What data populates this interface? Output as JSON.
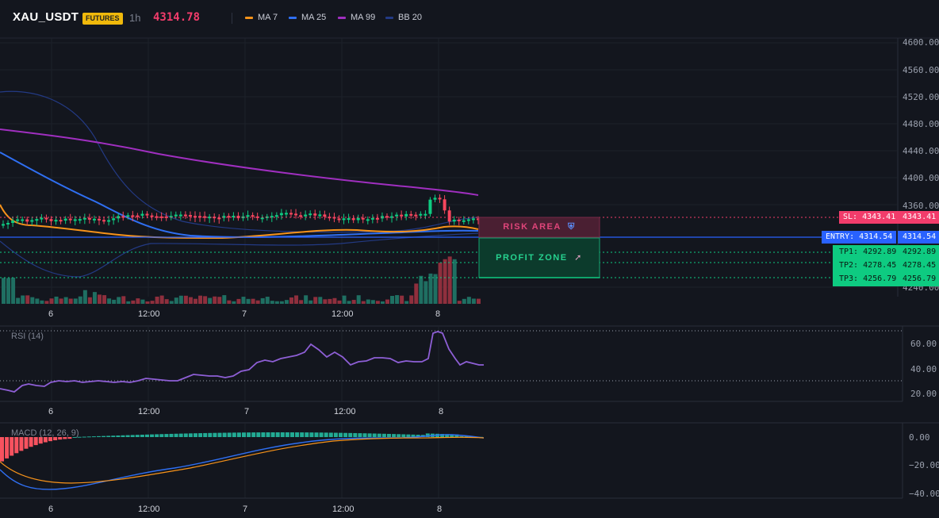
{
  "header": {
    "symbol": "XAU_USDT",
    "badge": "FUTURES",
    "timeframe": "1h",
    "price": "4314.78",
    "legend": [
      {
        "label": "MA 7",
        "color": "#f7931a"
      },
      {
        "label": "MA 25",
        "color": "#2f6ff2"
      },
      {
        "label": "MA 99",
        "color": "#a02fc0"
      },
      {
        "label": "BB 20",
        "color": "#233a84"
      }
    ]
  },
  "colors": {
    "up": "#26a69a",
    "down": "#ef5350",
    "up_bright": "#0ecb81",
    "down_bright": "#f6465d",
    "entry": "#2962ff",
    "sl": "#f23c6b",
    "tp": "#0ecb81",
    "rsi": "#8e5fd6",
    "macd": "#2f6ff2",
    "signal": "#f7931a"
  },
  "main_chart": {
    "price_axis": [
      "4600.00",
      "4560.00",
      "4520.00",
      "4480.00",
      "4440.00",
      "4400.00",
      "4360.00",
      "4240.00"
    ],
    "sl_label": "SL: 4343.41",
    "sl_price": "4343.41",
    "entry_label": "ENTRY: 4314.54",
    "entry_price": "4314.54",
    "tp_labels": [
      {
        "label": "TP1: 4292.89",
        "price": "4292.89"
      },
      {
        "label": "TP2: 4278.45",
        "price": "4278.45"
      },
      {
        "label": "TP3: 4256.79",
        "price": "4256.79"
      }
    ],
    "risk_label": "RISK AREA",
    "risk_icon": "shield-icon",
    "profit_label": "PROFIT ZONE",
    "profit_icon": "rocket-icon"
  },
  "time_axis": [
    "6",
    "12:00",
    "7",
    "12:00",
    "8"
  ],
  "rsi": {
    "title": "RSI (14)",
    "axis": [
      "60.00",
      "40.00",
      "20.00"
    ]
  },
  "macd": {
    "title": "MACD (12, 26, 9)",
    "axis": [
      "0.00",
      "−20.00",
      "−40.00"
    ]
  }
}
